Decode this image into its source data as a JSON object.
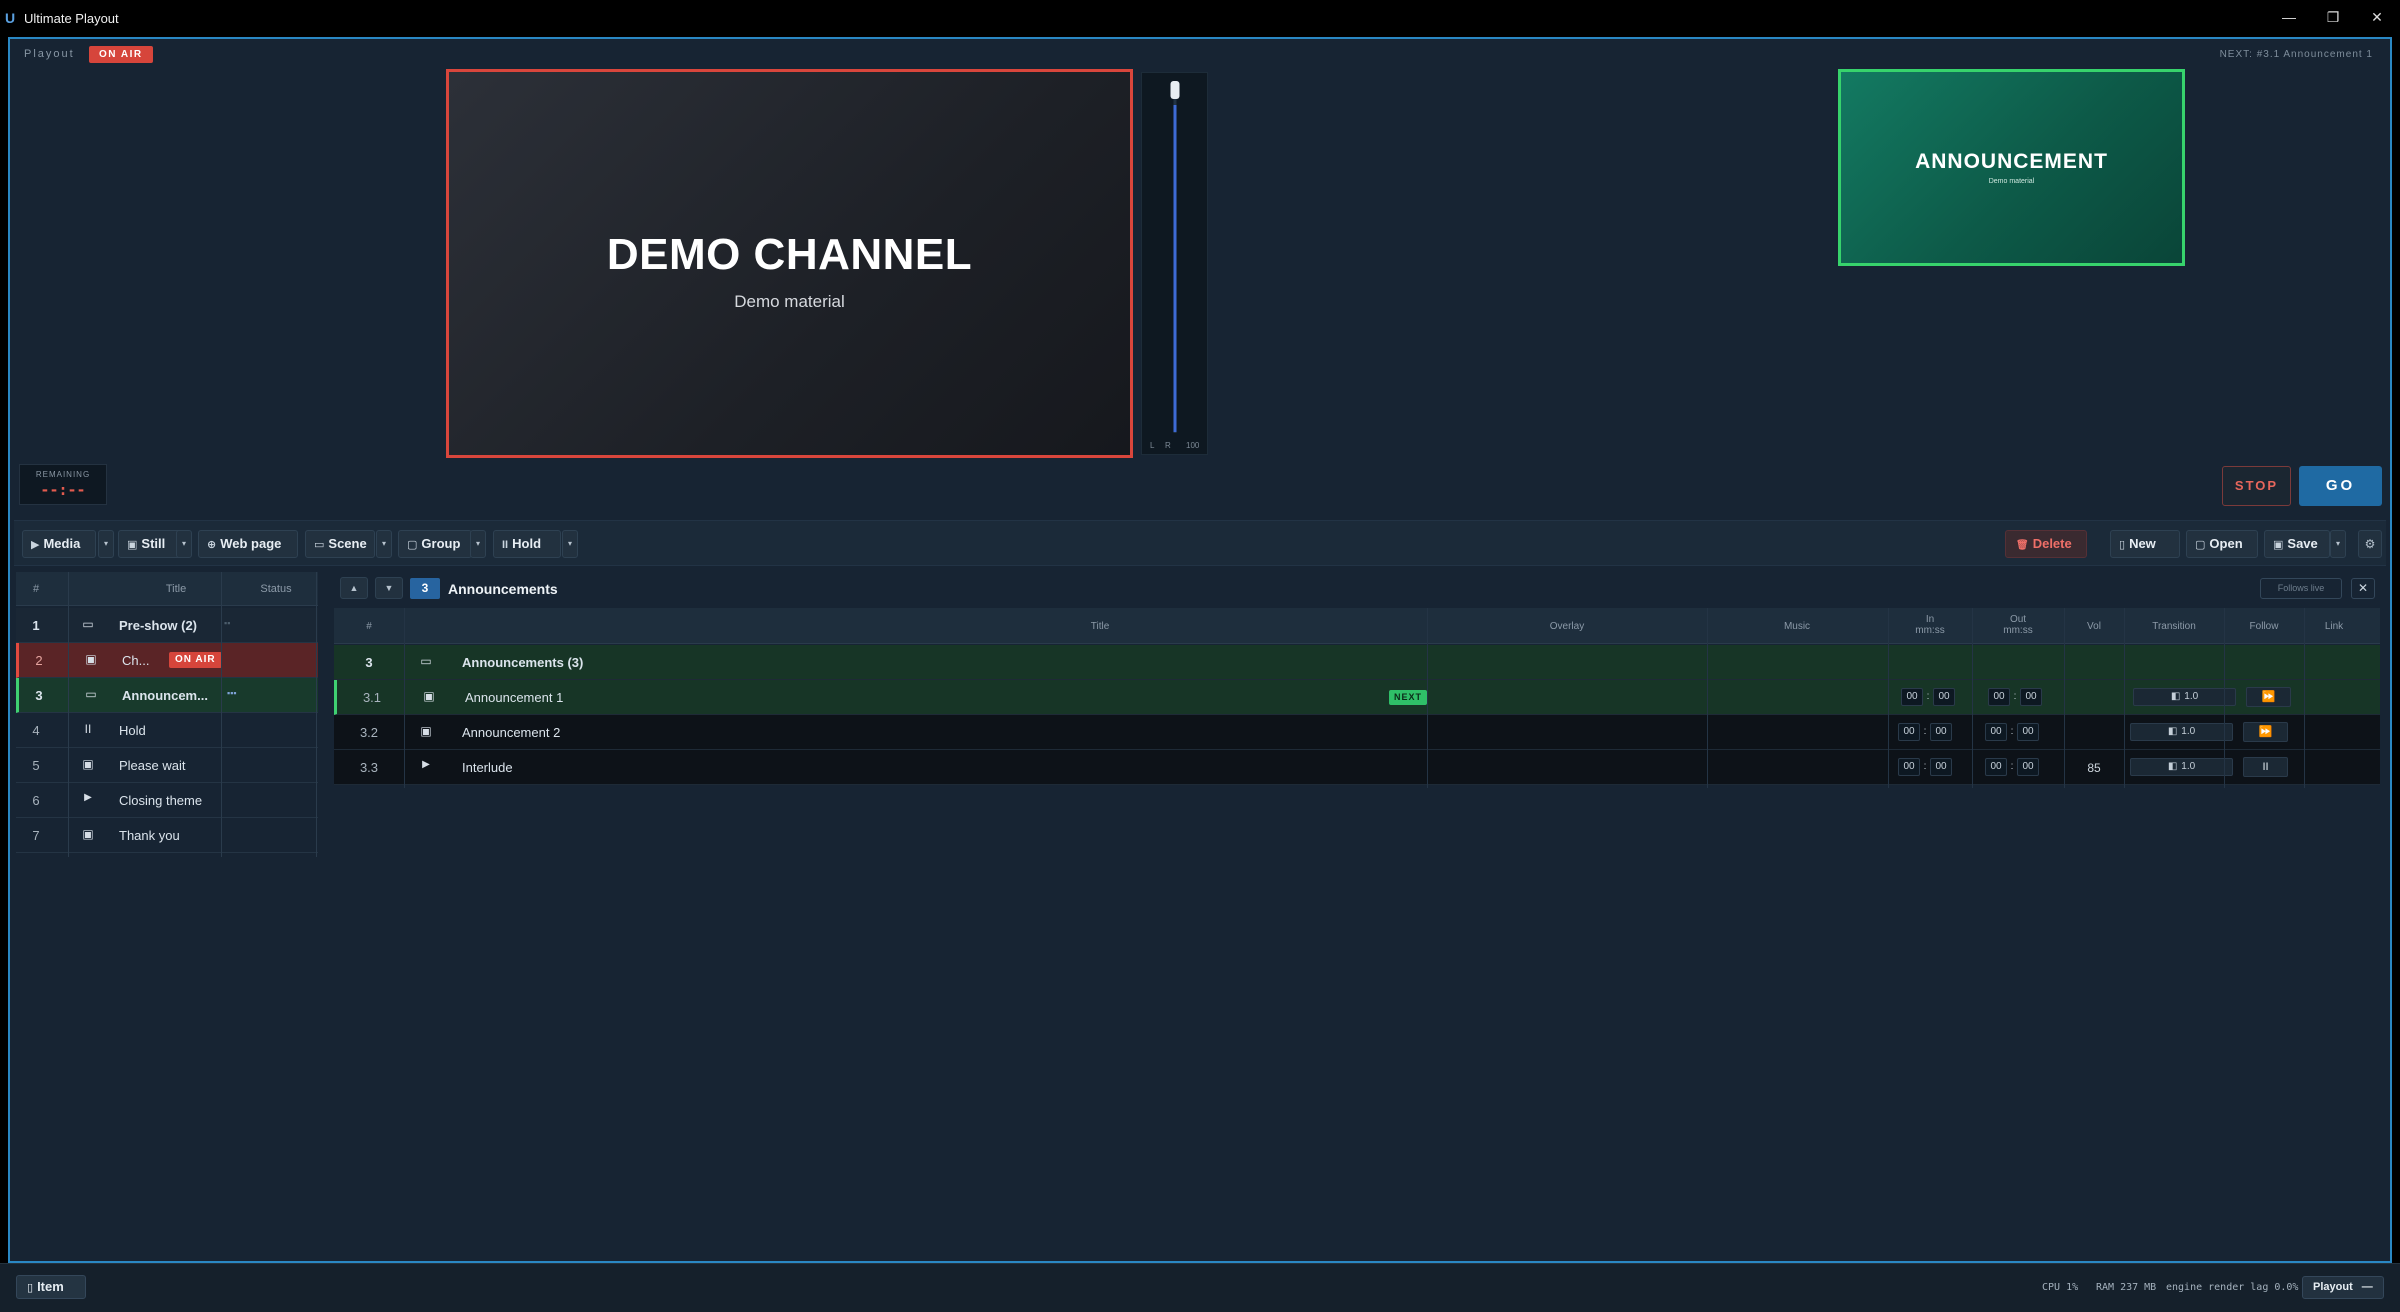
{
  "window": {
    "title": "Ultimate Playout",
    "logo": "U",
    "controls": [
      "—",
      "❐",
      "✕"
    ]
  },
  "playout": {
    "label": "Playout",
    "status_badge": "ON AIR",
    "next_info": "NEXT: #3.1  Announcement 1",
    "program": {
      "title": "DEMO CHANNEL",
      "subtitle": "Demo material"
    },
    "preview": {
      "title": "ANNOUNCEMENT",
      "subtitle": "Demo material"
    },
    "meter": {
      "left_label": "L",
      "right_label": "R",
      "scale_label": "100",
      "level_fraction": 0.99
    },
    "remaining": {
      "label": "REMAINING",
      "value": "--:--"
    },
    "stop_label": "STOP",
    "go_label": "GO"
  },
  "toolbar": {
    "media_label": "Media",
    "still_label": "Still",
    "webpage_label": "Web page",
    "scene_label": "Scene",
    "group_label": "Group",
    "hold_label": "Hold",
    "delete_label": "Delete",
    "new_label": "New",
    "open_label": "Open",
    "save_label": "Save",
    "icons": {
      "media": "▶",
      "still": "▣",
      "webpage": "⊕",
      "scene": "▭",
      "group": "▢",
      "hold": "II",
      "delete": "🗑",
      "new": "▯",
      "open": "▢",
      "save": "▣",
      "settings": "⚙",
      "dropdown": "▾"
    }
  },
  "left_panel": {
    "columns": [
      "#",
      "Title",
      "Status"
    ],
    "rows": [
      {
        "num": "1",
        "icon": "folder-icon",
        "title": "Pre-show  (2)",
        "status": "▪▪",
        "state": "group"
      },
      {
        "num": "2",
        "icon": "image-icon",
        "title": "Ch...",
        "status": "ON AIR",
        "state": "onair"
      },
      {
        "num": "3",
        "icon": "folder-icon",
        "title": "Announcem...",
        "status": "▪▪▪",
        "state": "selected"
      },
      {
        "num": "4",
        "icon": "pause-icon",
        "title": "Hold",
        "status": "",
        "state": "normal"
      },
      {
        "num": "5",
        "icon": "image-icon",
        "title": "Please wait",
        "status": "",
        "state": "normal"
      },
      {
        "num": "6",
        "icon": "play-icon",
        "title": "Closing theme",
        "status": "",
        "state": "normal"
      },
      {
        "num": "7",
        "icon": "image-icon",
        "title": "Thank you",
        "status": "",
        "state": "normal"
      }
    ]
  },
  "detail": {
    "group_number": "3",
    "group_title": "Announcements",
    "follows_live_label": "Follows live",
    "close_label": "✕",
    "columns": {
      "num": "#",
      "title": "Title",
      "overlay": "Overlay",
      "music": "Music",
      "in": "In",
      "in_unit": "mm:ss",
      "out": "Out",
      "out_unit": "mm:ss",
      "vol": "Vol",
      "transition": "Transition",
      "follow": "Follow",
      "link": "Link"
    },
    "group_row": {
      "num": "3",
      "title": "Announcements  (3)"
    },
    "rows": [
      {
        "num": "3.1",
        "icon": "image-icon",
        "title": "Announcement 1",
        "badge": "NEXT",
        "in_m": "00",
        "in_s": "00",
        "out_m": "00",
        "out_s": "00",
        "vol": "",
        "transition": "1.0",
        "follow": "⏩"
      },
      {
        "num": "3.2",
        "icon": "image-icon",
        "title": "Announcement 2",
        "badge": "",
        "in_m": "00",
        "in_s": "00",
        "out_m": "00",
        "out_s": "00",
        "vol": "",
        "transition": "1.0",
        "follow": "⏩"
      },
      {
        "num": "3.3",
        "icon": "play-icon",
        "title": "Interlude",
        "badge": "",
        "in_m": "00",
        "in_s": "00",
        "out_m": "00",
        "out_s": "00",
        "vol": "85",
        "transition": "1.0",
        "follow": "II"
      }
    ]
  },
  "statusbar": {
    "item_label": "Item",
    "cpu": "CPU 1%",
    "ram": "RAM 237 MB",
    "engine": "engine render lag 0.0%",
    "mode_label": "Playout",
    "mode_suffix": "—"
  },
  "colors": {
    "onair": "#d6453b",
    "next": "#2fbf68",
    "accent": "#2a88c4",
    "background": "#172433"
  }
}
